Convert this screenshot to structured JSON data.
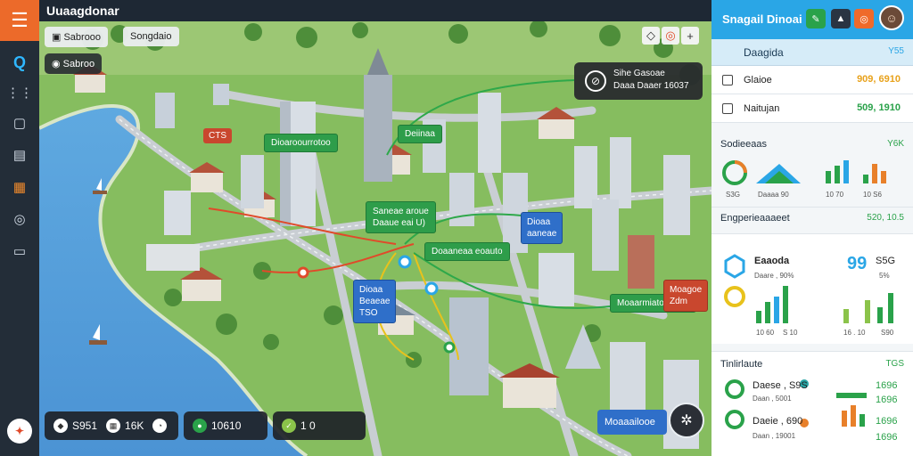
{
  "app": {
    "title": "Uuaagdonar"
  },
  "map_toolbar": {
    "tab1": "Sabrooo",
    "tab2": "Songdaio",
    "mode_chip": "Sabroo",
    "zoom_ctrl": "◇",
    "record_ctrl": "◎",
    "add_ctrl": "+"
  },
  "labels": {
    "g1": "Dioaroourrotoo",
    "g2": "Deiinaa",
    "g3": "Saneae aroue",
    "g3b": "Daaue eai U)",
    "g4": "Doaaneaa eoauto",
    "g5": "Moaarmiatoaa AG",
    "r1": "CTS",
    "b1a": "Dioaa",
    "b1b": "aaneae",
    "b2a": "Dioaa",
    "b2b": "Beaeae",
    "b2c": "TSO",
    "b3a": "Moagoe",
    "b3b": "Zdm"
  },
  "tooltip": {
    "line1": "Sihe Gasoae",
    "line2": "Daaa Daaer 16037",
    "icon": "clock-icon"
  },
  "bottom_bar": {
    "left_val1": "S951",
    "left_val2": "16K",
    "mid_val": "10610",
    "right_val": "1 0"
  },
  "corner": {
    "badge": "Moaaailooe"
  },
  "panel": {
    "title": "Snagail Dinoai",
    "tab": {
      "label": "Daagida",
      "value": "Y55"
    },
    "rows": [
      {
        "label": "Glaioe",
        "value": "909, 6910",
        "color": "#e8a21c"
      },
      {
        "label": "Naitujan",
        "value": "509, 1910",
        "color": "#2aa24a"
      }
    ],
    "section1": {
      "title": "Sodieeaas",
      "right": "Y6K",
      "minis": [
        "S3G",
        "Daaaa 90",
        "10 70",
        "10 S6"
      ]
    },
    "section2": {
      "title": "Engperieaaaeet",
      "right": "520, 10.5"
    },
    "section3": {
      "title": "Eaaoda",
      "sub": "Daare , 90%",
      "big": "99",
      "big_sub": "S5G",
      "big_sub2": "5%",
      "minis": [
        "10 60",
        "S 10"
      ],
      "right_minis": [
        "16 . 10",
        "S90"
      ]
    },
    "section4": {
      "title": "Tinlirlaute",
      "right": "TGS",
      "items": [
        {
          "label": "Daese , S9S",
          "sub": "Daan , 5001",
          "value": "1696",
          "color": "#2aa24a"
        },
        {
          "label": "Daeie , 690",
          "sub": "Daan , 19001",
          "value": "1696",
          "color": "#e8802a"
        }
      ],
      "extras": [
        "1696",
        "1696"
      ]
    },
    "colors": {
      "accent": "#2aa6e6",
      "green": "#2aa24a",
      "orange": "#e8802a"
    }
  }
}
